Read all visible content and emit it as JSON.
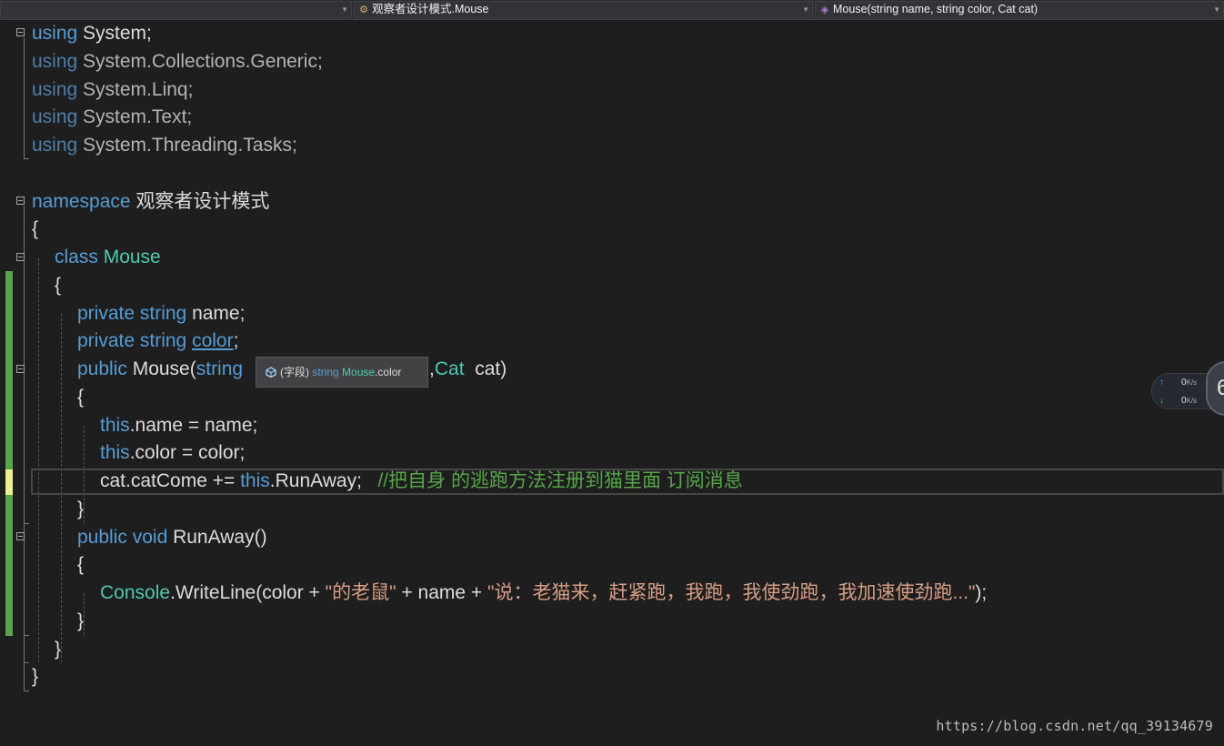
{
  "navbar": {
    "project_label": "",
    "class_label": "观察者设计模式.Mouse",
    "member_label": "Mouse(string name, string color, Cat cat)",
    "class_icon": "class-icon",
    "member_icon": "method-icon"
  },
  "code": {
    "line1": {
      "kw": "using",
      "rest": " System;"
    },
    "line2": {
      "kw": "using",
      "rest": " System.Collections.Generic;"
    },
    "line3": {
      "kw": "using",
      "rest": " System.Linq;"
    },
    "line4": {
      "kw": "using",
      "rest": " System.Text;"
    },
    "line5": {
      "kw": "using",
      "rest": " System.Threading.Tasks;"
    },
    "line7": {
      "kw": "namespace",
      "rest": " 观察者设计模式"
    },
    "line8": "{",
    "line9": {
      "kw": "class",
      "type": "Mouse"
    },
    "line10": "{",
    "line11": {
      "kw1": "private",
      "kw2": "string",
      "rest": " name;"
    },
    "line12": {
      "kw1": "private",
      "kw2": "string",
      "field": "color",
      "rest": ";"
    },
    "line13": {
      "kw1": "public",
      "name": " Mouse(",
      "kw2": "string",
      "type": "Cat",
      "rest": "  cat)",
      "pre_type": ","
    },
    "line14": "{",
    "line15": {
      "kw": "this",
      "rest": ".name = name;"
    },
    "line16": {
      "kw": "this",
      "rest": ".color = color;"
    },
    "line17": {
      "pre": "cat.catCome += ",
      "kw": "this",
      "rest": ".RunAway;",
      "comment": "//把自身 的逃跑方法注册到猫里面 订阅消息"
    },
    "line18": "}",
    "line19": {
      "kw1": "public",
      "kw2": "void",
      "rest": " RunAway()"
    },
    "line20": "{",
    "line21": {
      "type": "Console",
      "pre": ".WriteLine(color + ",
      "str1": "\"的老鼠\"",
      "mid": " + name + ",
      "str2": "\"说：老猫来，赶紧跑，我跑，我使劲跑，我加速使劲跑...\"",
      "rest": ");"
    },
    "line22": "}",
    "line23": "}",
    "line24": "}"
  },
  "tooltip": {
    "kind": "(字段)",
    "type": "string",
    "class": "Mouse",
    "member": ".color",
    "icon": "field-icon"
  },
  "netspeed": {
    "up_value": "0",
    "down_value": "0",
    "unit": "K/s",
    "badge": "6",
    "up_icon": "arrow-up-icon",
    "down_icon": "arrow-down-icon"
  },
  "watermark": "https://blog.csdn.net/qq_39134679",
  "colors": {
    "background": "#1e1e1e",
    "keyword": "#569cd6",
    "type": "#4ec9b0",
    "string": "#d69d85",
    "comment": "#57a64a",
    "text": "#dcdcdc"
  }
}
